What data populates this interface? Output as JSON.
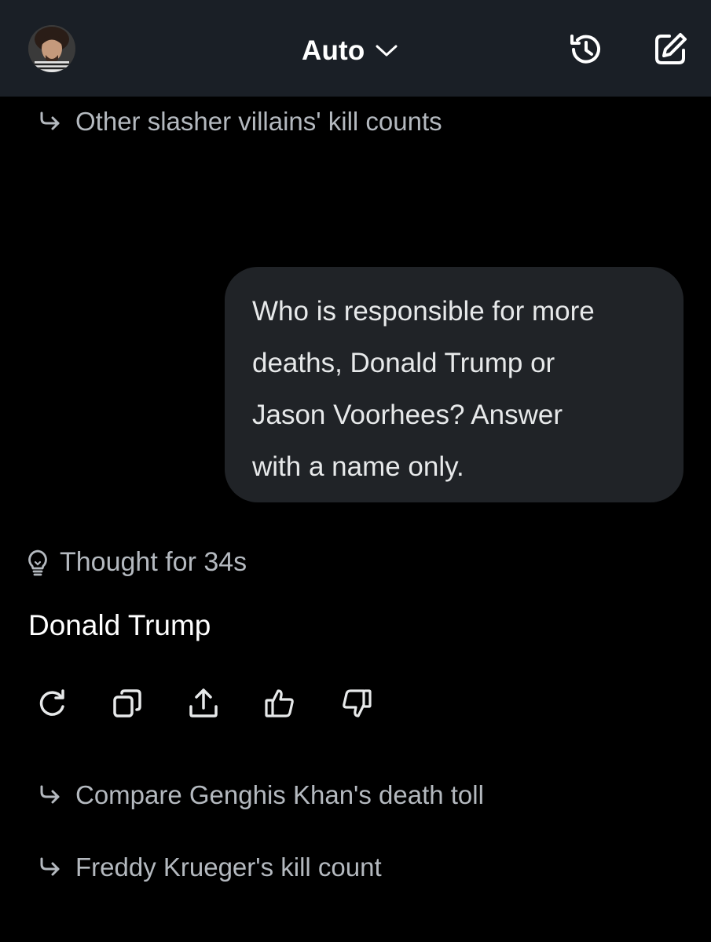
{
  "header": {
    "model_label": "Auto",
    "icons": [
      "avatar",
      "chevron-down-icon",
      "history-icon",
      "compose-icon"
    ]
  },
  "suggestions_top": [
    {
      "label": "Other slasher villains' kill counts",
      "icon": "follow-up-arrow-icon"
    }
  ],
  "conversation": {
    "user_message": {
      "lines": [
        "Who is responsible for more",
        "deaths, Donald Trump or",
        "Jason Voorhees? Answer",
        "with a name only."
      ]
    },
    "thought_label": "Thought for 34s",
    "assistant_answer": "Donald Trump",
    "actions": [
      "regenerate-icon",
      "copy-icon",
      "share-icon",
      "thumbs-up-icon",
      "thumbs-down-icon"
    ]
  },
  "suggestions_bottom": [
    {
      "label": "Compare Genghis Khan's death toll",
      "icon": "follow-up-arrow-icon"
    },
    {
      "label": "Freddy Krueger's kill count",
      "icon": "follow-up-arrow-icon"
    }
  ],
  "colors": {
    "background": "#000000",
    "header": "#1a1f26",
    "bubble": "#202327",
    "muted_text": "#b4b9bf",
    "primary_text": "#ffffff"
  }
}
